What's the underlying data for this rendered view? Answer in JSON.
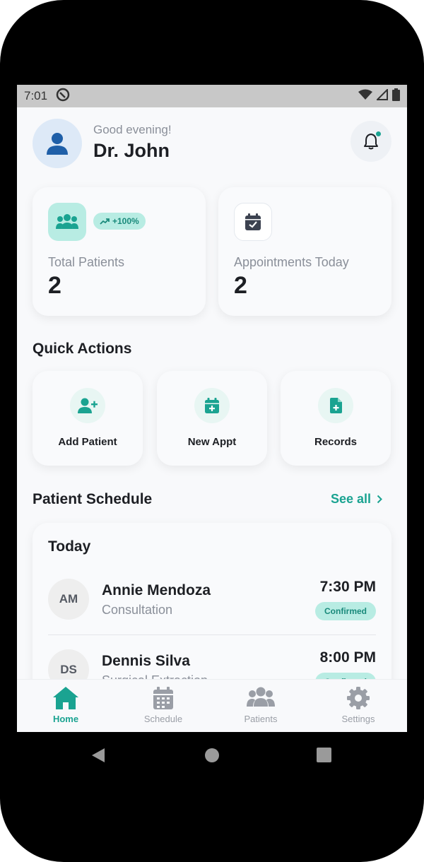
{
  "status_bar": {
    "time": "7:01"
  },
  "header": {
    "greeting": "Good evening!",
    "doctor_name": "Dr. John"
  },
  "stats": [
    {
      "label": "Total Patients",
      "value": "2",
      "trend": "+100%"
    },
    {
      "label": "Appointments Today",
      "value": "2"
    }
  ],
  "quick_actions": {
    "title": "Quick Actions",
    "items": [
      {
        "label": "Add Patient",
        "icon": "add-user-icon"
      },
      {
        "label": "New Appt",
        "icon": "calendar-plus-icon"
      },
      {
        "label": "Records",
        "icon": "file-plus-icon"
      }
    ]
  },
  "schedule": {
    "title": "Patient Schedule",
    "see_all": "See all",
    "day_label": "Today",
    "appointments": [
      {
        "initials": "AM",
        "name": "Annie Mendoza",
        "type": "Consultation",
        "time": "7:30 PM",
        "status": "Confirmed"
      },
      {
        "initials": "DS",
        "name": "Dennis Silva",
        "type": "Surgical Extraction",
        "time": "8:00 PM",
        "status": "Confirmed"
      }
    ]
  },
  "bottom_nav": {
    "active": "Home",
    "items": [
      {
        "label": "Home",
        "icon": "home-icon"
      },
      {
        "label": "Schedule",
        "icon": "calendar-icon"
      },
      {
        "label": "Patients",
        "icon": "users-icon"
      },
      {
        "label": "Settings",
        "icon": "gear-icon"
      }
    ]
  },
  "colors": {
    "accent": "#1aa391",
    "accent_light": "#b8ece3",
    "avatar_blue": "#1f5fa8"
  }
}
